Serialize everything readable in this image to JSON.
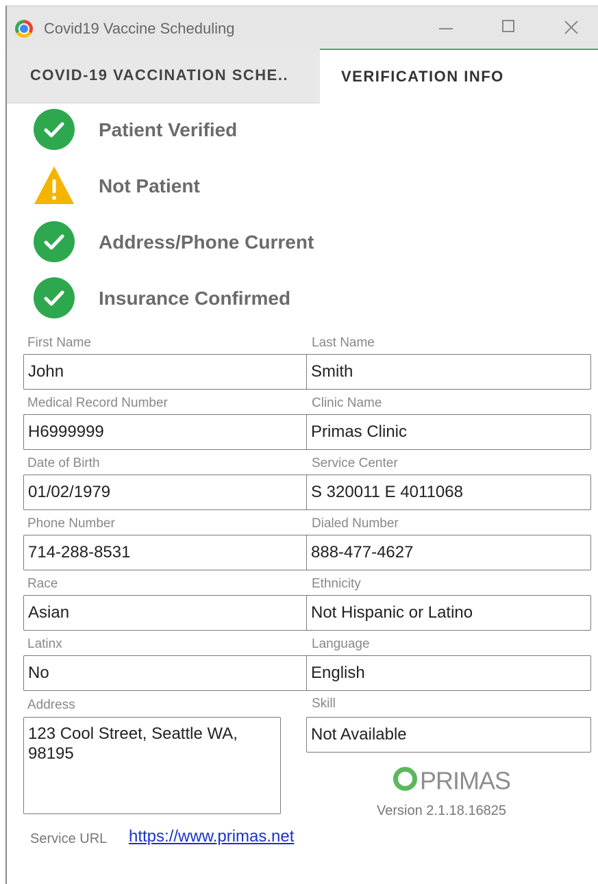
{
  "window": {
    "title": "Covid19 Vaccine Scheduling",
    "icon": "chrome-icon",
    "controls": [
      "minimize-icon",
      "maximize-icon",
      "close-icon"
    ]
  },
  "tabs": [
    {
      "label": "COVID-19 VACCINATION SCHE..",
      "active": false
    },
    {
      "label": "VERIFICATION INFO",
      "active": true
    }
  ],
  "status": [
    {
      "label": "Patient Verified",
      "icon": "check-circle-icon",
      "color": "#34a853"
    },
    {
      "label": "Not Patient",
      "icon": "warning-triangle-icon",
      "color": "#f4b400"
    },
    {
      "label": "Address/Phone Current",
      "icon": "check-circle-icon",
      "color": "#34a853"
    },
    {
      "label": "Insurance Confirmed",
      "icon": "check-circle-icon",
      "color": "#34a853"
    }
  ],
  "fields": {
    "first_name": {
      "label": "First Name",
      "value": "John"
    },
    "last_name": {
      "label": "Last Name",
      "value": "Smith"
    },
    "mrn": {
      "label": "Medical Record Number",
      "value": "H6999999"
    },
    "clinic_name": {
      "label": "Clinic Name",
      "value": "Primas Clinic"
    },
    "dob": {
      "label": "Date of Birth",
      "value": "01/02/1979"
    },
    "service_center": {
      "label": "Service Center",
      "value": "S 320011 E 4011068"
    },
    "phone": {
      "label": "Phone Number",
      "value": "714-288-8531"
    },
    "dialed_number": {
      "label": "Dialed Number",
      "value": "888-477-4627"
    },
    "race": {
      "label": "Race",
      "value": "Asian"
    },
    "ethnicity": {
      "label": "Ethnicity",
      "value": "Not Hispanic or Latino"
    },
    "latinx": {
      "label": "Latinx",
      "value": "No"
    },
    "language": {
      "label": "Language",
      "value": "English"
    },
    "address": {
      "label": "Address",
      "value": "123 Cool Street, Seattle WA, 98195"
    },
    "skill": {
      "label": "Skill",
      "value": "Not Available"
    }
  },
  "branding": {
    "logo_text": "PRIMAS",
    "logo_color": "#5cb85c",
    "version": "Version 2.1.18.16825"
  },
  "service_url": {
    "label": "Service URL",
    "link": "https://www.primas.net"
  }
}
